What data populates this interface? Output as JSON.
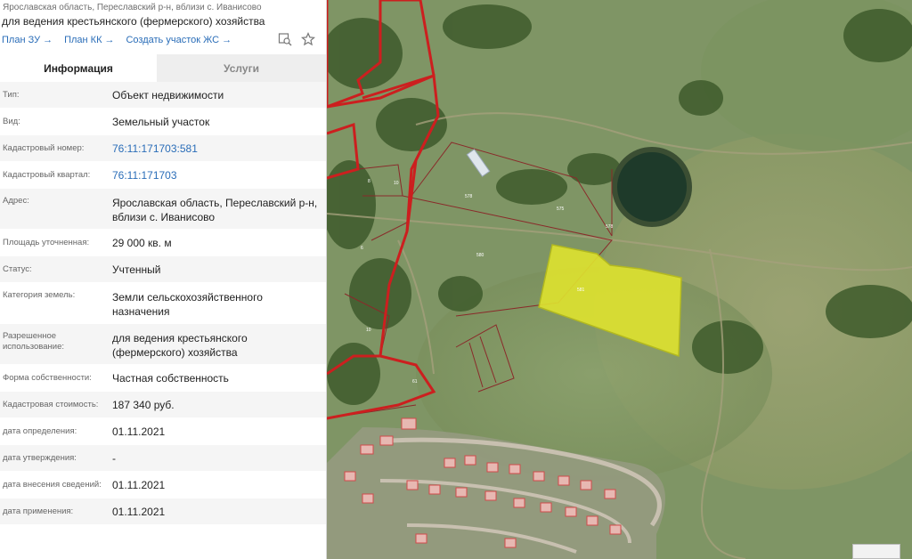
{
  "header": {
    "subtitle": "Ярославская область, Переславский р-н, вблизи с. Иванисово",
    "title": "для ведения крестьянского (фермерского) хозяйства",
    "links": [
      {
        "label": "План ЗУ",
        "arrow": "→"
      },
      {
        "label": "План КК",
        "arrow": "→"
      },
      {
        "label": "Создать участок ЖС",
        "arrow": "→"
      }
    ],
    "icons": [
      "search-map-icon",
      "star-icon"
    ]
  },
  "tabs": [
    {
      "label": "Информация",
      "active": true
    },
    {
      "label": "Услуги",
      "active": false
    }
  ],
  "rows": [
    {
      "label": "Тип:",
      "value": "Объект недвижимости"
    },
    {
      "label": "Вид:",
      "value": "Земельный участок"
    },
    {
      "label": "Кадастровый номер:",
      "value": "76:11:171703:581"
    },
    {
      "label": "Кадастровый квартал:",
      "value": "76:11:171703"
    },
    {
      "label": "Адрес:",
      "value": "Ярославская область, Переславский р-н, вблизи с. Иванисово"
    },
    {
      "label": "Площадь уточненная:",
      "value": "29 000 кв. м"
    },
    {
      "label": "Статус:",
      "value": "Учтенный"
    },
    {
      "label": "Категория земель:",
      "value": "Земли сельскохозяйственного назначения"
    },
    {
      "label": "Разрешенное использование:",
      "value": "для ведения крестьянского (фермерского) хозяйства"
    },
    {
      "label": "Форма собственности:",
      "value": "Частная собственность"
    },
    {
      "label": "Кадастровая стоимость:",
      "value": "187 340 руб."
    },
    {
      "label": "дата определения:",
      "value": "01.11.2021"
    },
    {
      "label": "дата утверждения:",
      "value": "-"
    },
    {
      "label": "дата внесения сведений:",
      "value": "01.11.2021"
    },
    {
      "label": "дата применения:",
      "value": "01.11.2021"
    }
  ],
  "map": {
    "labels": [
      "8",
      "10",
      "578",
      "575",
      "578",
      "580",
      "6",
      "10",
      "581",
      "61"
    ],
    "colors": {
      "field": "#7f9565",
      "quarter_border": "#cc1f1f",
      "parcel_border": "#8a2a2a",
      "selected_fill": "#dfe32f",
      "pond": "#1e3a2a",
      "link": "#2a6db8"
    }
  }
}
